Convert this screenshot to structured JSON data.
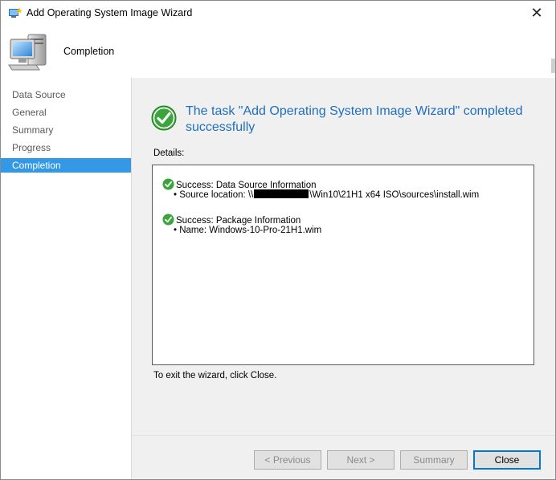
{
  "window": {
    "title": "Add Operating System Image Wizard",
    "close_glyph": "✕"
  },
  "header": {
    "title": "Completion",
    "icon": "computer-icon"
  },
  "sidebar": {
    "items": [
      {
        "label": "Data Source",
        "active": false
      },
      {
        "label": "General",
        "active": false
      },
      {
        "label": "Summary",
        "active": false
      },
      {
        "label": "Progress",
        "active": false
      },
      {
        "label": "Completion",
        "active": true
      }
    ]
  },
  "main": {
    "headline": "The task \"Add Operating System Image Wizard\" completed successfully",
    "details_label": "Details:",
    "entries": [
      {
        "status": "Success: Data Source Information",
        "detail_prefix": "• Source location: \\\\",
        "detail_suffix": "\\Win10\\21H1 x64 ISO\\sources\\install.wim"
      },
      {
        "status": "Success: Package Information",
        "detail": "• Name: Windows-10-Pro-21H1.wim"
      }
    ],
    "exit_text": "To exit the wizard, click Close."
  },
  "buttons": {
    "previous": "< Previous",
    "next": "Next >",
    "summary": "Summary",
    "close": "Close"
  },
  "colors": {
    "accent": "#3399e6",
    "headline": "#1f6fc0",
    "success": "#3aa53a"
  }
}
